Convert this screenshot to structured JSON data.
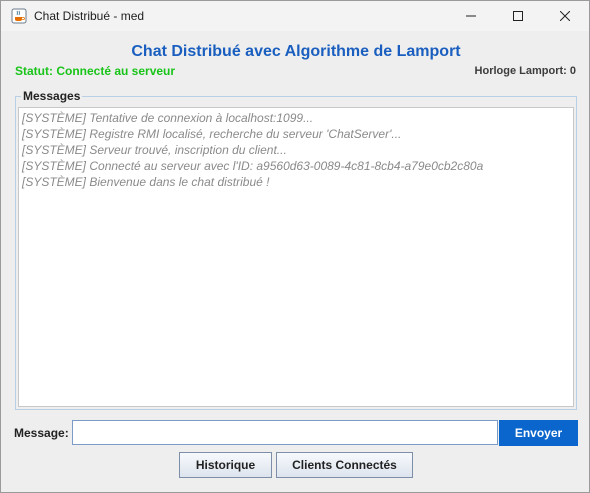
{
  "window": {
    "title": "Chat Distribué - med",
    "icon": "java-cup-icon"
  },
  "header": {
    "title": "Chat Distribué avec Algorithme de Lamport",
    "status": "Statut: Connecté au serveur",
    "clock": "Horloge Lamport: 0"
  },
  "messages": {
    "legend": "Messages",
    "lines": [
      "[SYSTÈME] Tentative de connexion à localhost:1099...",
      "[SYSTÈME] Registre RMI localisé, recherche du serveur 'ChatServer'...",
      "[SYSTÈME] Serveur trouvé, inscription du client...",
      "[SYSTÈME] Connecté au serveur avec l'ID: a9560d63-0089-4c81-8cb4-a79e0cb2c80a",
      "[SYSTÈME] Bienvenue dans le chat distribué !"
    ]
  },
  "composer": {
    "label": "Message:",
    "value": "",
    "send_label": "Envoyer"
  },
  "actions": {
    "history_label": "Historique",
    "clients_label": "Clients Connectés"
  },
  "colors": {
    "title": "#1a5fbf",
    "status": "#19c419",
    "send_button": "#0a66cc"
  }
}
